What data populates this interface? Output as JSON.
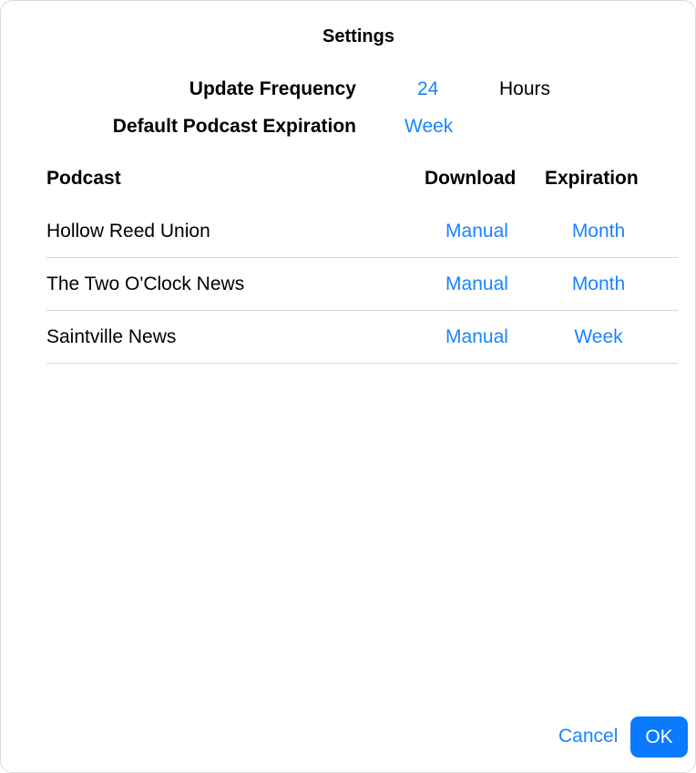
{
  "dialog": {
    "title": "Settings"
  },
  "settings": {
    "update_frequency": {
      "label": "Update Frequency",
      "value": "24",
      "unit": "Hours"
    },
    "default_expiration": {
      "label": "Default Podcast Expiration",
      "value": "Week"
    }
  },
  "table": {
    "headers": {
      "podcast": "Podcast",
      "download": "Download",
      "expiration": "Expiration"
    },
    "rows": [
      {
        "name": "Hollow Reed Union",
        "download": "Manual",
        "expiration": "Month"
      },
      {
        "name": "The Two O'Clock News",
        "download": "Manual",
        "expiration": "Month"
      },
      {
        "name": "Saintville News",
        "download": "Manual",
        "expiration": "Week"
      }
    ]
  },
  "buttons": {
    "cancel": "Cancel",
    "ok": "OK"
  },
  "colors": {
    "accent": "#1a84ff",
    "primary_button": "#0a7aff",
    "separator": "#d9d9dc"
  }
}
